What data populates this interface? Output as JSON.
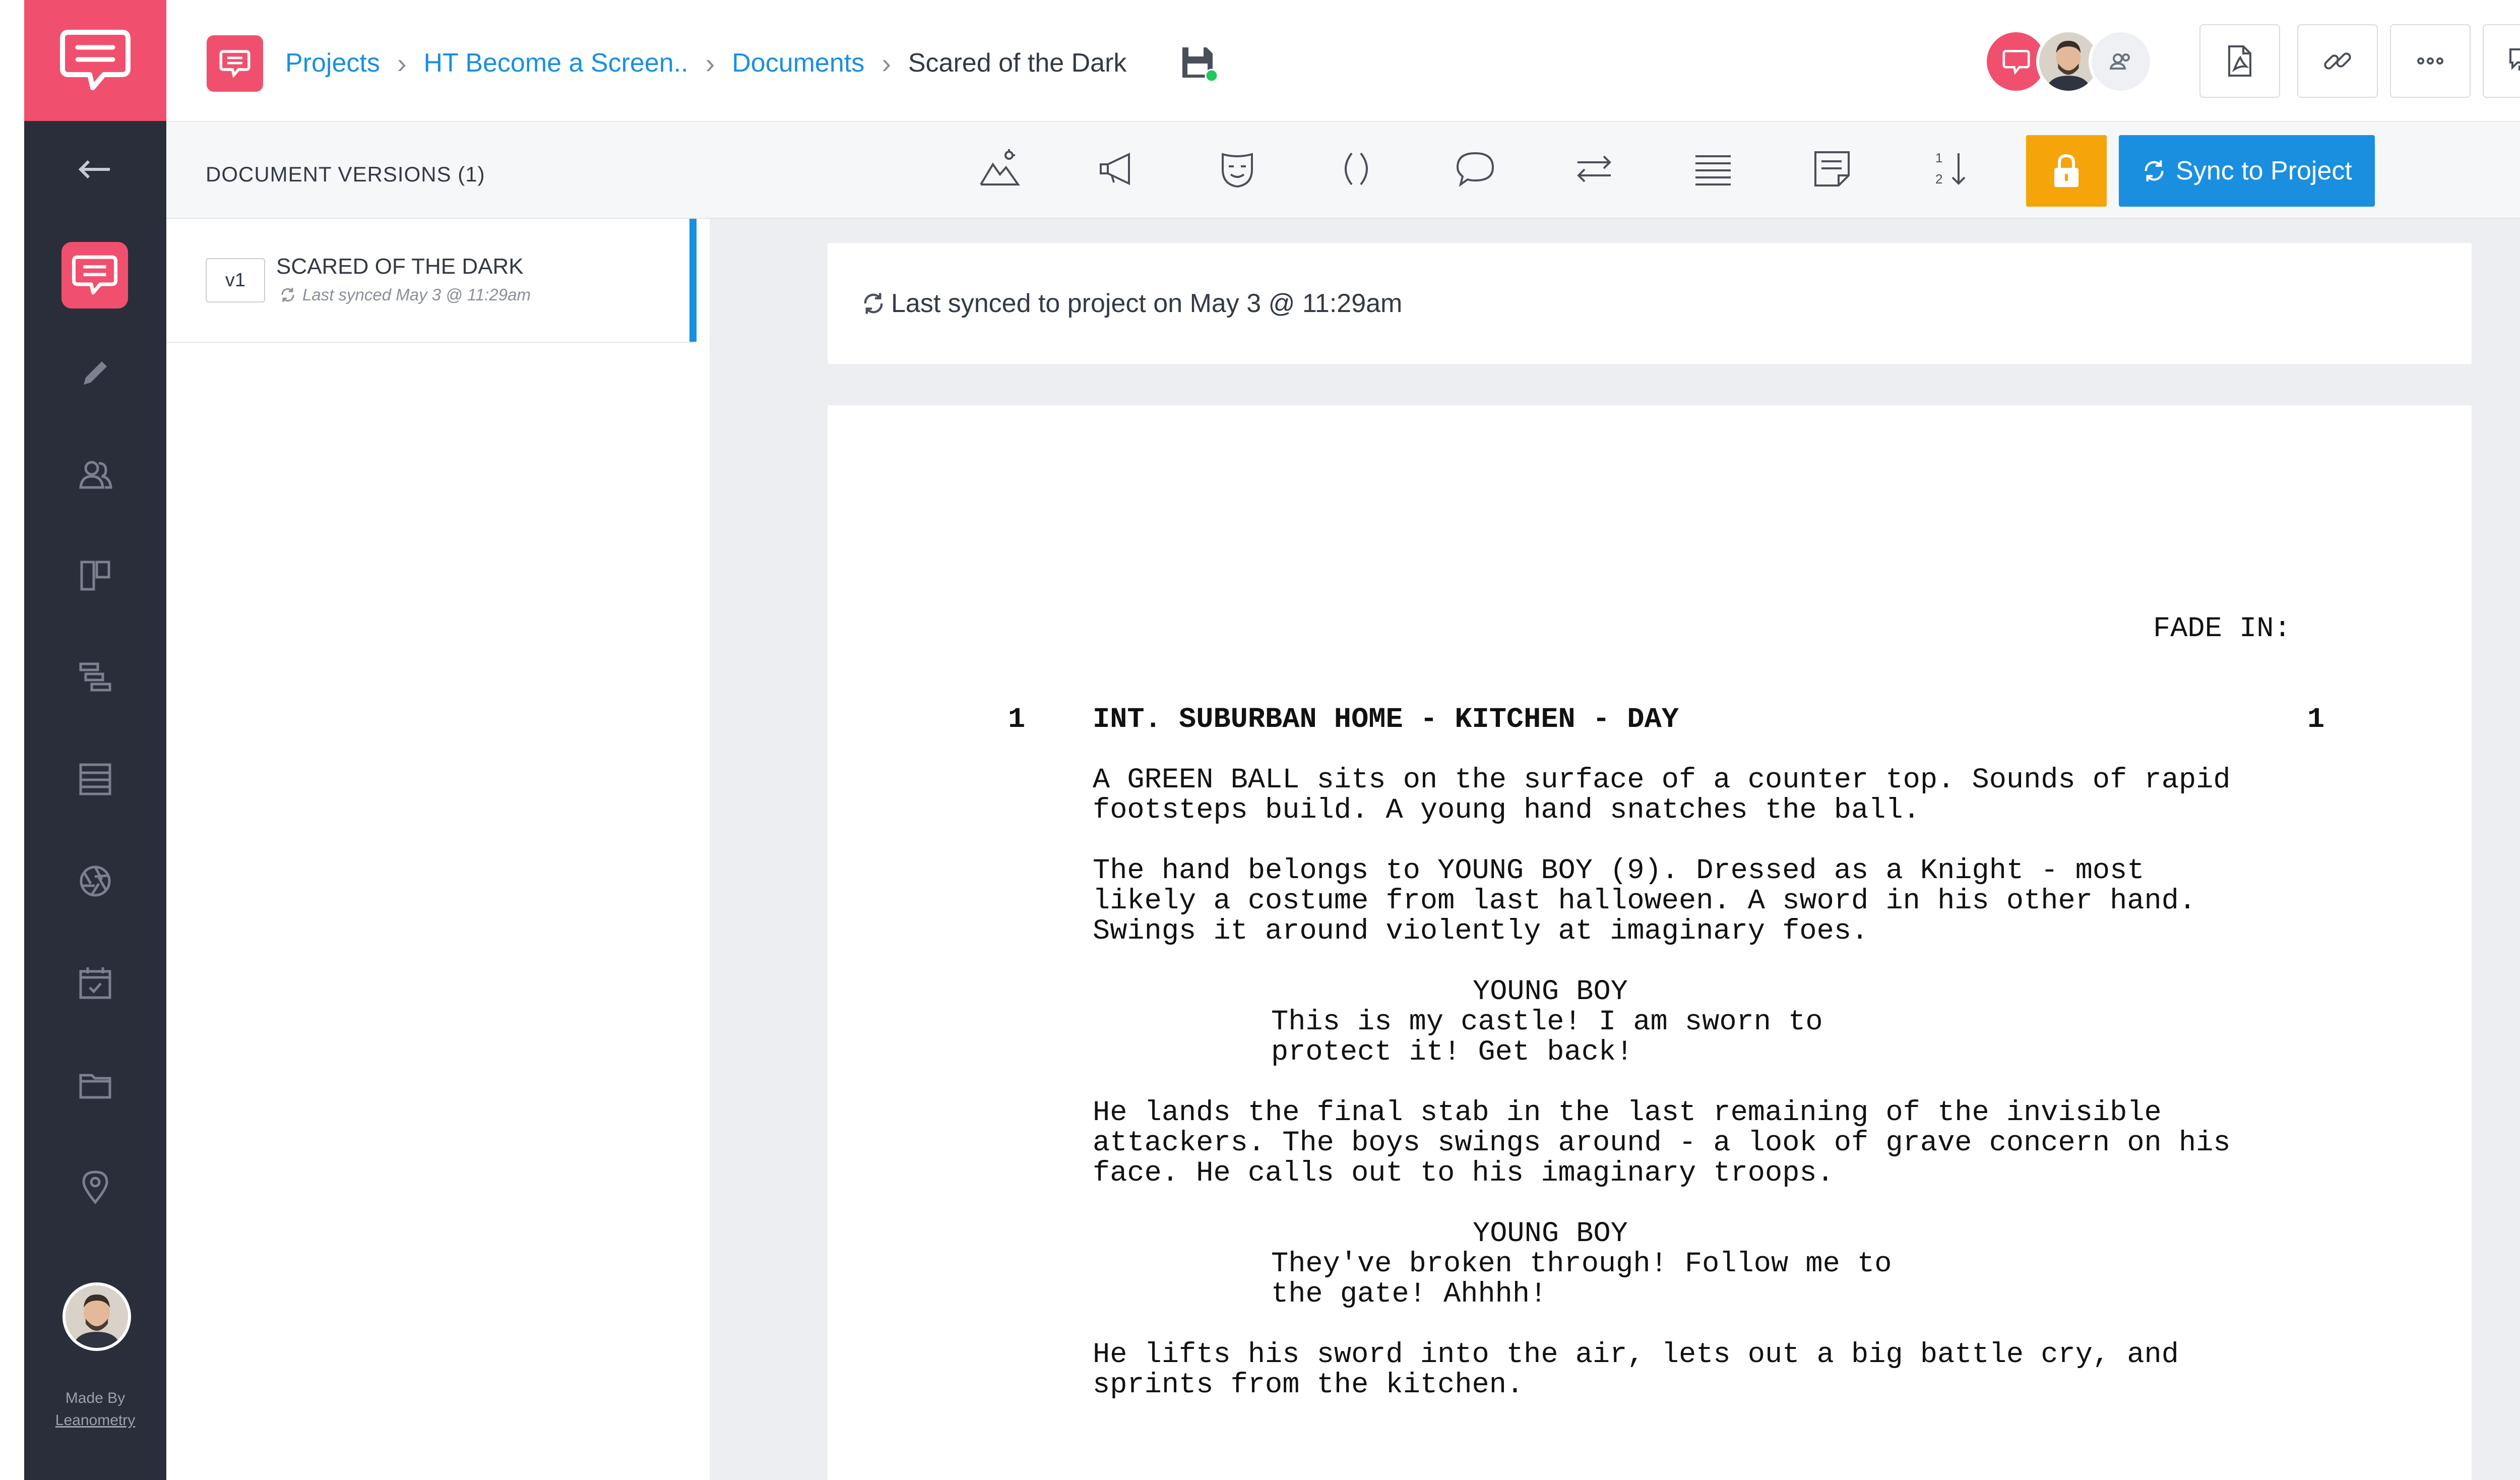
{
  "nav": {
    "icons": [
      "back-arrow-icon",
      "speech-bubble-icon",
      "pencil-icon",
      "users-icon",
      "board-icon",
      "timeline-icon",
      "list-icon",
      "aperture-icon",
      "calendar-icon",
      "folder-icon",
      "location-pin-icon"
    ],
    "made_by": "Made By",
    "made_by_link": "Leanometry"
  },
  "header": {
    "breadcrumb": [
      "Projects",
      "HT Become a Screen..",
      "Documents"
    ],
    "current": "Scared of the Dark",
    "buttons": [
      "pdf-export-icon",
      "link-icon",
      "more-icon",
      "comments-icon"
    ]
  },
  "versions": {
    "title": "DOCUMENT VERSIONS (1)",
    "item": {
      "badge": "v1",
      "name": "SCARED OF THE DARK",
      "sub": "Last synced May 3 @ 11:29am"
    }
  },
  "toolbar": {
    "tools": [
      "scene-mountain-icon",
      "megaphone-icon",
      "mask-icon",
      "parenthetical-icon",
      "dialogue-bubble-icon",
      "transition-icon",
      "action-lines-icon",
      "note-icon",
      "scene-numbering-icon"
    ],
    "sync_label": "Sync to Project"
  },
  "sync_card": {
    "text": "Last synced to project on May 3 @ 11:29am"
  },
  "script": {
    "fade_in": "FADE IN:",
    "scene_number_left": "1",
    "scene_number_right": "1",
    "scene_heading": "INT. SUBURBAN HOME - KITCHEN - DAY",
    "action1": "A GREEN BALL sits on the surface of a counter top. Sounds of rapid\nfootsteps build. A young hand snatches the ball.",
    "action2": "The hand belongs to YOUNG BOY (9). Dressed as a Knight - most\nlikely a costume from last halloween. A sword in his other hand.\nSwings it around violently at imaginary foes.",
    "character1": "YOUNG BOY",
    "dialogue1": "This is my castle! I am sworn to\nprotect it! Get back!",
    "action3": "He lands the final stab in the last remaining of the invisible\nattackers. The boys swings around - a look of grave concern on his\nface. He calls out to his imaginary troops.",
    "character2": "YOUNG BOY",
    "dialogue2": "They've broken through! Follow me to\nthe gate! Ahhhh!",
    "action4": "He lifts his sword into the air, lets out a big battle cry, and\nsprints from the kitchen."
  },
  "colors": {
    "brand": "#f0506e",
    "accent": "#1a8fe0",
    "lock": "#f5a50a",
    "nav_bg": "#2a2e3a",
    "online": "#22c55e"
  }
}
